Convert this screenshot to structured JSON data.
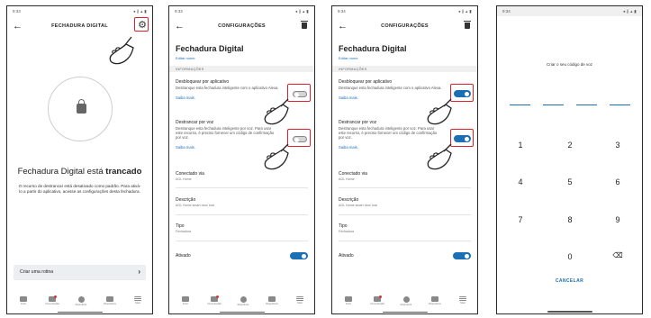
{
  "status_bar": {
    "time_p1": "9:33",
    "time_p2": "9:33",
    "time_p3": "9:34",
    "time_p4": "9:34"
  },
  "panel1": {
    "title": "FECHADURA DIGITAL",
    "lock_status_prefix": "Fechadura Digital está",
    "lock_status_state": "trancado",
    "description": "O recurso de destrancar está desativado como padrão. Para ativá-lo a partir do aplicativo, acesse as configurações desta fechadura.",
    "routine_label": "Criar uma rotina"
  },
  "settings": {
    "title": "CONFIGURAÇÕES",
    "device_name": "Fechadura Digital",
    "edit_name": "Editar nome",
    "section_header": "INFORMAÇÕES",
    "unlock_app": {
      "title": "Desbloquear por aplicativo",
      "desc": "Destranque esta fechadura inteligente com o aplicativo Alexa.",
      "link": "Saiba mais."
    },
    "unlock_voice": {
      "title": "Destrancar por voz",
      "desc": "Destranque esta fechadura inteligente por voz. Para usar este recurso, é preciso fornecer um código de confirmação por voz.",
      "link": "Saiba mais."
    },
    "connected_via": {
      "title": "Conectado via",
      "value": "AGL Home"
    },
    "description": {
      "title": "Descrição",
      "value": "AGL Home smart door lock"
    },
    "type": {
      "title": "Tipo",
      "value": "Fechadura"
    },
    "enabled": {
      "title": "Ativado"
    },
    "toggle_state_panel2": {
      "unlock_app": false,
      "unlock_voice": false,
      "enabled": true
    },
    "toggle_state_panel3": {
      "unlock_app": true,
      "unlock_voice": true,
      "enabled": true
    }
  },
  "bottom_nav": [
    {
      "label": "Início",
      "icon": "home-icon"
    },
    {
      "label": "Comunicação",
      "icon": "chat-icon"
    },
    {
      "label": "Reproduzir",
      "icon": "play-icon"
    },
    {
      "label": "Dispositivos",
      "icon": "devices-icon"
    },
    {
      "label": "Mais",
      "icon": "menu-icon"
    }
  ],
  "panel4": {
    "prompt": "Criar o seu código de voz",
    "keys": [
      "1",
      "2",
      "3",
      "4",
      "5",
      "6",
      "7",
      "8",
      "9",
      "0"
    ],
    "backspace_icon": "backspace-icon",
    "cancel_label": "CANCELAR"
  },
  "colors": {
    "accent": "#1a6fb5",
    "highlight": "#e0202a",
    "section_bg": "#f0f0f0"
  }
}
